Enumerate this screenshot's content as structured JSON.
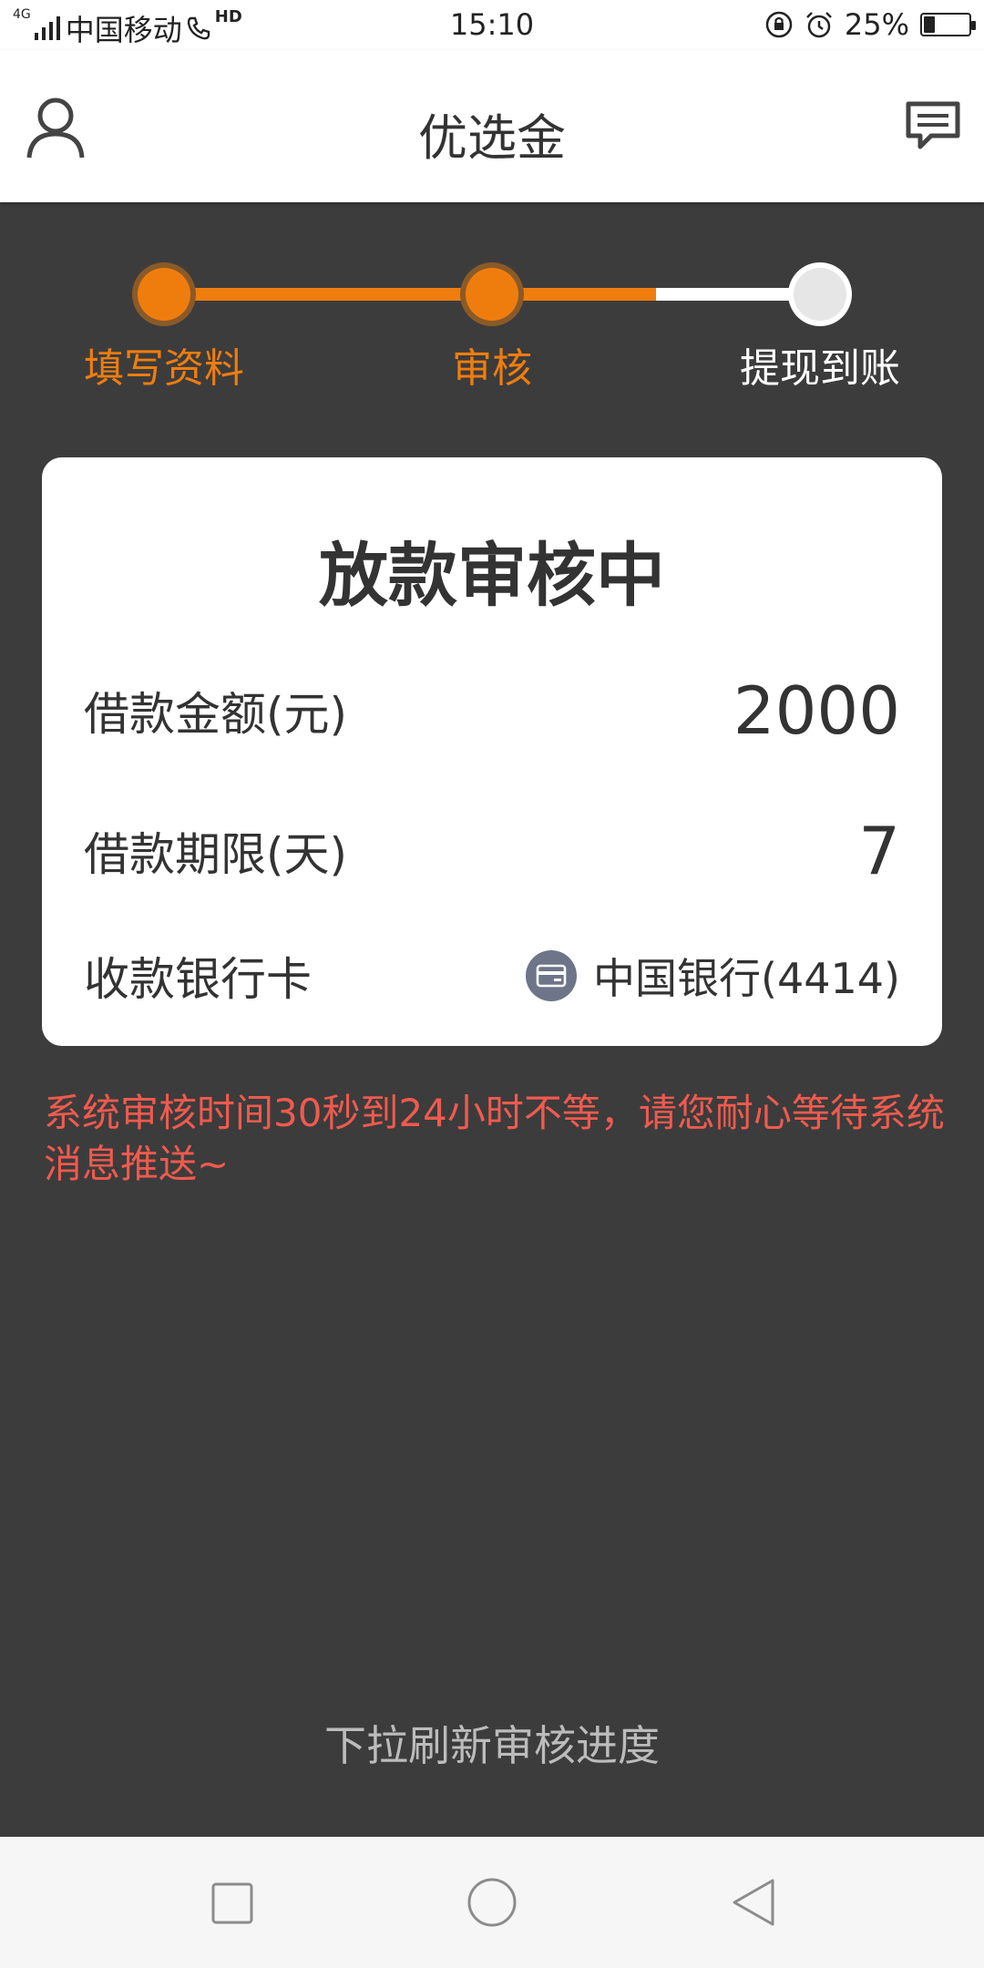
{
  "status_bar": {
    "network": "4G",
    "carrier": "中国移动",
    "hd": "HD",
    "time": "15:10",
    "battery_percent": "25%",
    "battery_level": 0.25
  },
  "header": {
    "title": "优选金",
    "user_icon": "user-icon",
    "message_icon": "message-icon"
  },
  "stepper": {
    "steps": [
      {
        "label": "填写资料",
        "state": "done"
      },
      {
        "label": "审核",
        "state": "done"
      },
      {
        "label": "提现到账",
        "state": "todo"
      }
    ],
    "progress": 0.75,
    "accent_color": "#ef7d0e"
  },
  "card": {
    "title": "放款审核中",
    "amount_label": "借款金额(元)",
    "amount_value": "2000",
    "term_label": "借款期限(天)",
    "term_value": "7",
    "bank_label": "收款银行卡",
    "bank_icon": "bank-card-icon",
    "bank_value": "中国银行(4414)"
  },
  "notice": "系统审核时间30秒到24小时不等，请您耐心等待系统消息推送~",
  "pull_hint": "下拉刷新审核进度",
  "nav": {
    "recents_icon": "square-icon",
    "home_icon": "circle-icon",
    "back_icon": "triangle-back-icon"
  }
}
